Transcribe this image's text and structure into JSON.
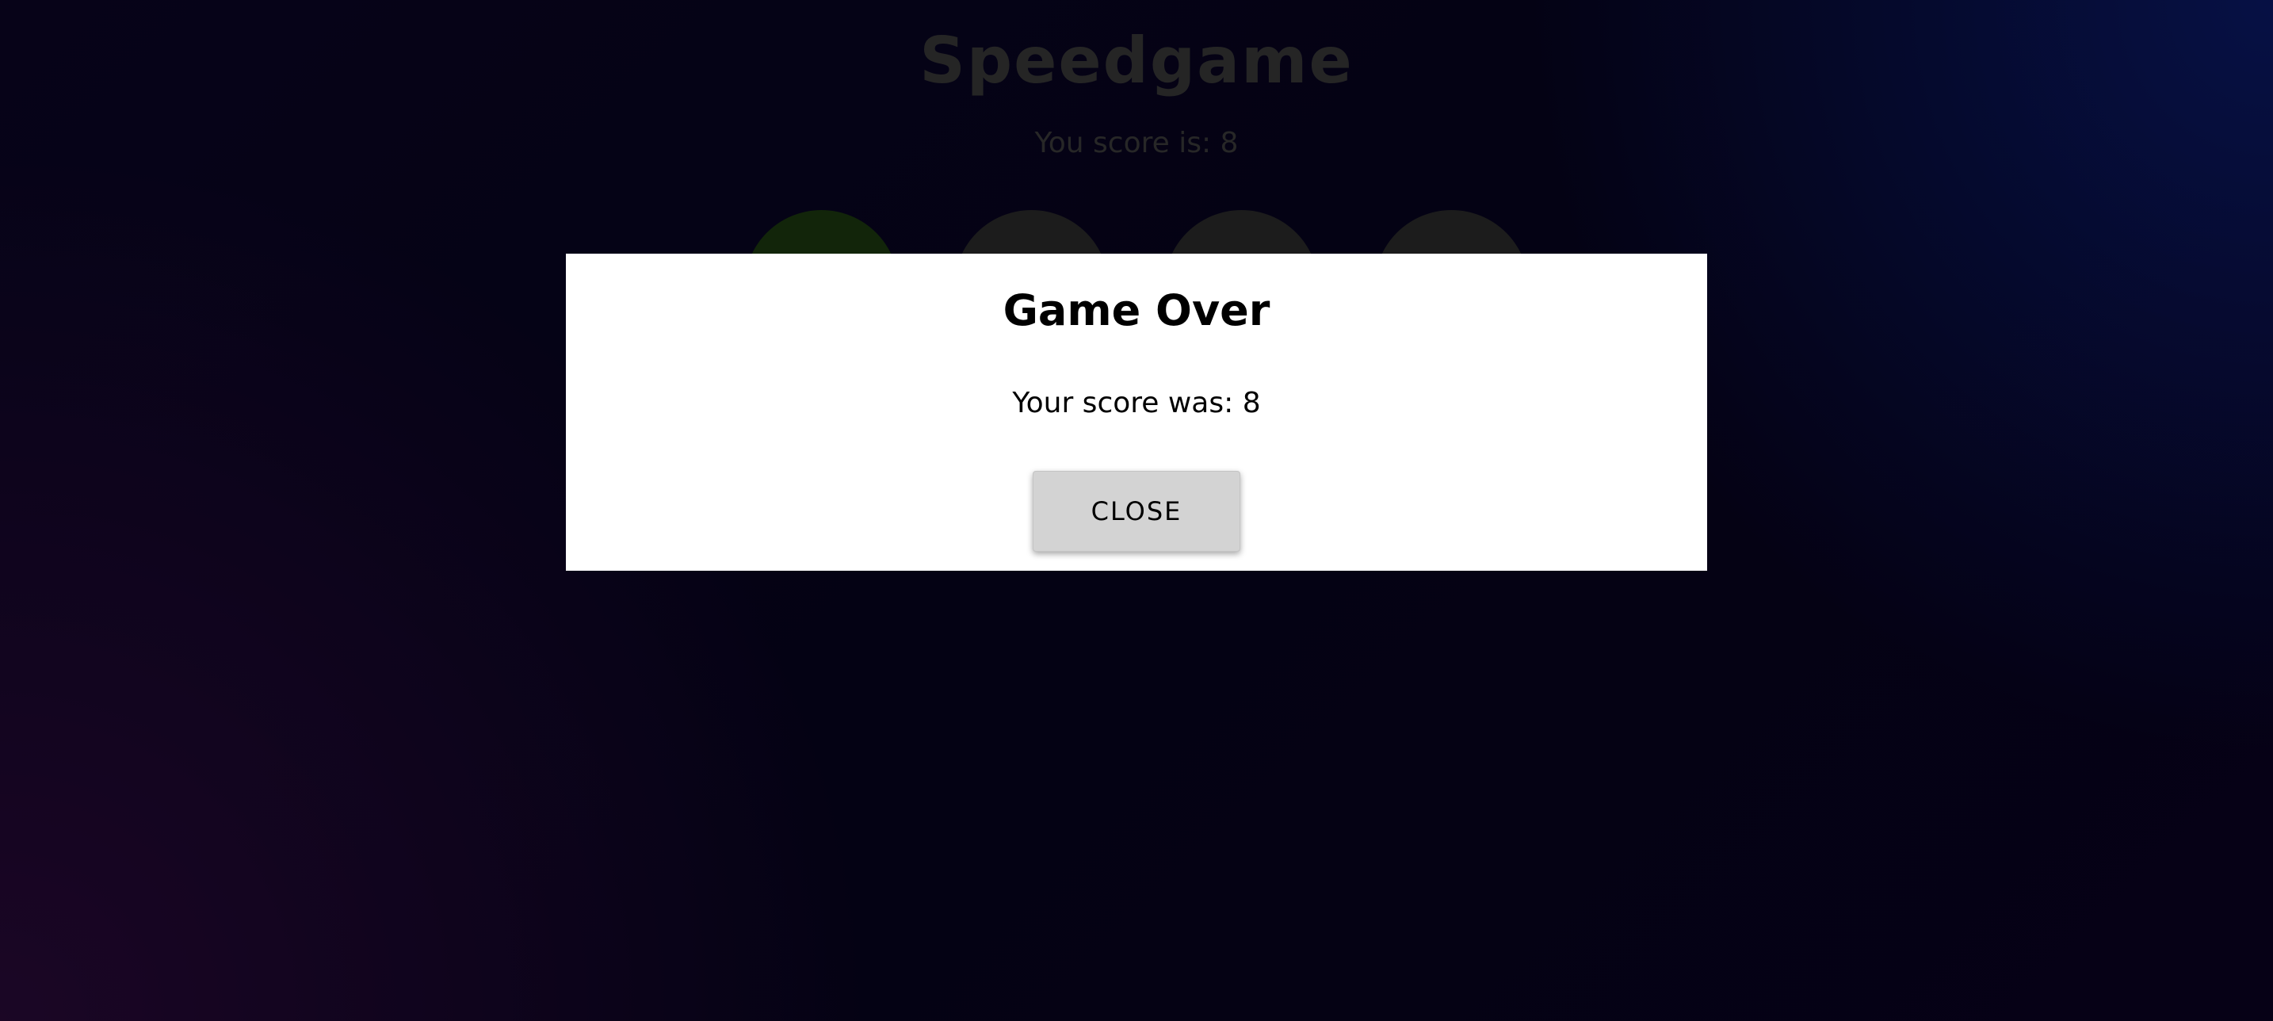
{
  "game": {
    "title": "Speedgame",
    "score_text": "You score is: 8",
    "circles": [
      {
        "state": "active",
        "color": "#1c3a10"
      },
      {
        "state": "idle",
        "color": "#2b2b2b"
      },
      {
        "state": "idle",
        "color": "#2b2b2b"
      },
      {
        "state": "idle",
        "color": "#2b2b2b"
      }
    ]
  },
  "modal": {
    "title": "Game Over",
    "message": "Your score was: 8",
    "close_label": "CLOSE"
  }
}
